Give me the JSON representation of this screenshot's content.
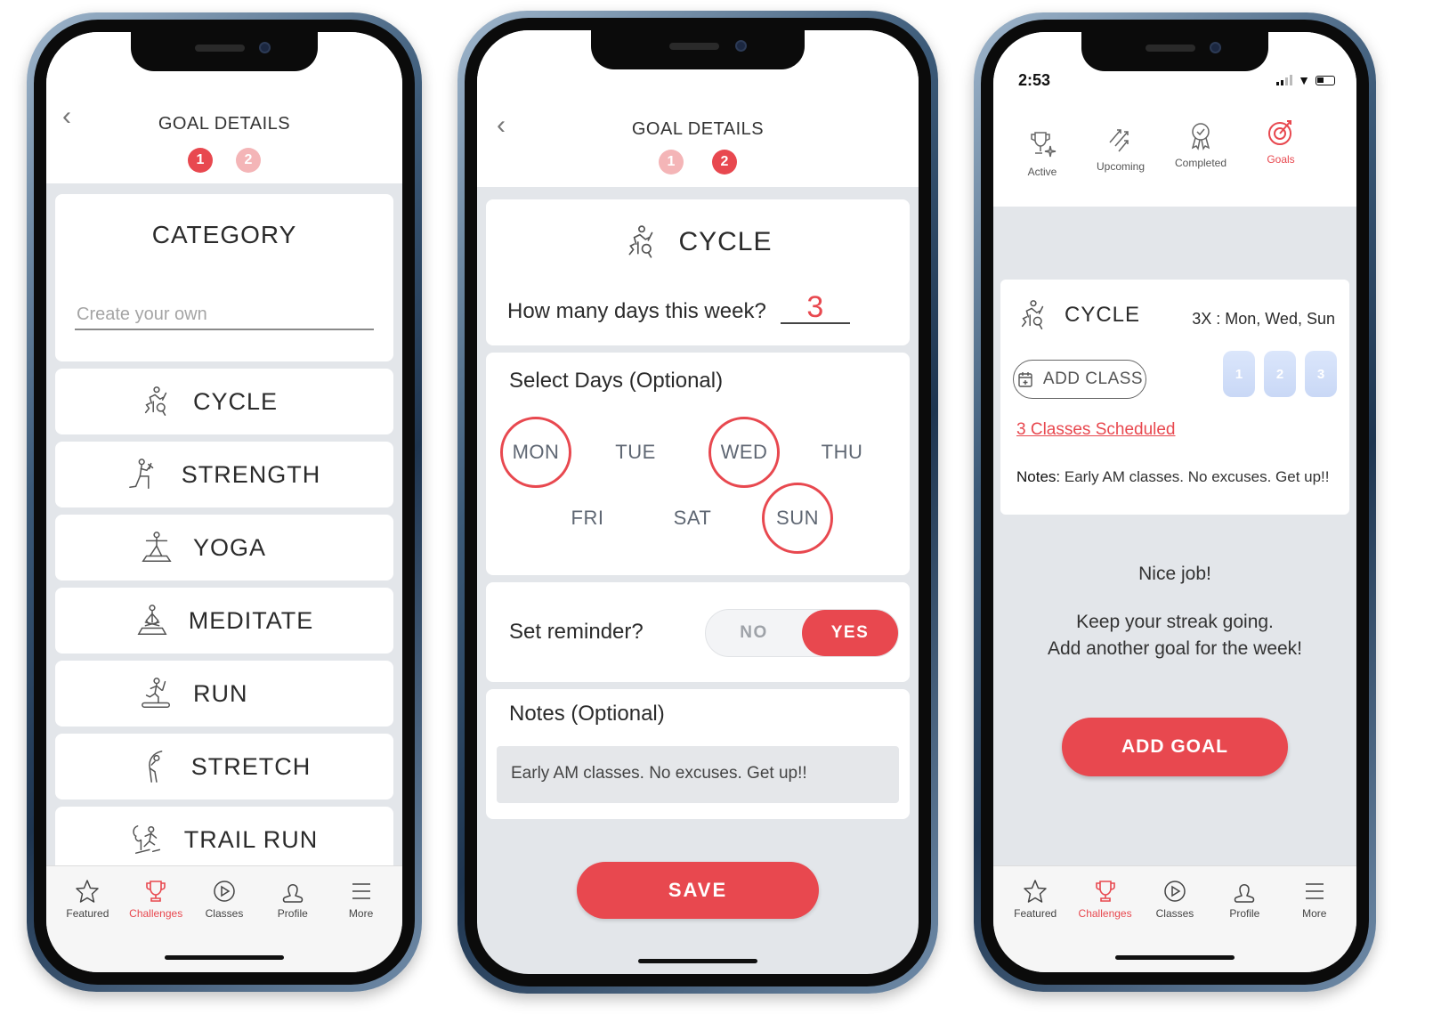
{
  "colors": {
    "accent": "#e8484f",
    "accent_light": "#f4b5b7",
    "background": "#e3e6ea",
    "badge": "#d3e0f8"
  },
  "screen1": {
    "header": {
      "title": "GOAL DETAILS",
      "steps": [
        "1",
        "2"
      ],
      "active_step": 1
    },
    "category": {
      "title": "CATEGORY",
      "input_placeholder": "Create your own"
    },
    "categories": [
      {
        "label": "CYCLE",
        "icon": "cycle-icon"
      },
      {
        "label": "STRENGTH",
        "icon": "strength-icon"
      },
      {
        "label": "YOGA",
        "icon": "yoga-icon"
      },
      {
        "label": "MEDITATE",
        "icon": "meditate-icon"
      },
      {
        "label": "RUN",
        "icon": "run-icon"
      },
      {
        "label": "STRETCH",
        "icon": "stretch-icon"
      },
      {
        "label": "TRAIL RUN",
        "icon": "trail-run-icon"
      }
    ]
  },
  "screen2": {
    "header": {
      "title": "GOAL DETAILS",
      "steps": [
        "1",
        "2"
      ],
      "active_step": 2
    },
    "goal": {
      "category": "CYCLE",
      "days_question": "How many days this week?",
      "days_value": "3"
    },
    "select_days": {
      "title": "Select Days (Optional)",
      "days": [
        {
          "label": "MON",
          "selected": true
        },
        {
          "label": "TUE",
          "selected": false
        },
        {
          "label": "WED",
          "selected": true
        },
        {
          "label": "THU",
          "selected": false
        },
        {
          "label": "FRI",
          "selected": false
        },
        {
          "label": "SAT",
          "selected": false
        },
        {
          "label": "SUN",
          "selected": true
        }
      ]
    },
    "reminder": {
      "label": "Set reminder?",
      "options": [
        "NO",
        "YES"
      ],
      "selected": "YES"
    },
    "notes": {
      "title": "Notes (Optional)",
      "value": "Early AM classes. No excuses. Get up!!"
    },
    "save_label": "SAVE"
  },
  "screen3": {
    "status_bar": {
      "time": "2:53"
    },
    "top_tabs": [
      {
        "label": "Active",
        "icon": "trophy-sparkle-icon"
      },
      {
        "label": "Upcoming",
        "icon": "arrows-up-right-icon"
      },
      {
        "label": "Completed",
        "icon": "award-ribbon-icon"
      },
      {
        "label": "Goals",
        "icon": "target-icon",
        "active": true
      }
    ],
    "goal_card": {
      "category": "CYCLE",
      "schedule": "3X : Mon, Wed, Sun",
      "add_class_label": "ADD CLASS",
      "badges": [
        "1",
        "2",
        "3"
      ],
      "scheduled_link": "3  Classes Scheduled",
      "notes_label": "Notes:",
      "notes_value": "Early AM classes. No excuses. Get up!!"
    },
    "message": {
      "line1": "Nice job!",
      "line2": "Keep your streak going.",
      "line3": "Add another goal for the week!"
    },
    "add_goal_label": "ADD GOAL"
  },
  "tabbar": [
    {
      "label": "Featured",
      "icon": "star-icon"
    },
    {
      "label": "Challenges",
      "icon": "trophy-icon",
      "active": true
    },
    {
      "label": "Classes",
      "icon": "play-circle-icon"
    },
    {
      "label": "Profile",
      "icon": "profile-icon"
    },
    {
      "label": "More",
      "icon": "menu-icon"
    }
  ]
}
